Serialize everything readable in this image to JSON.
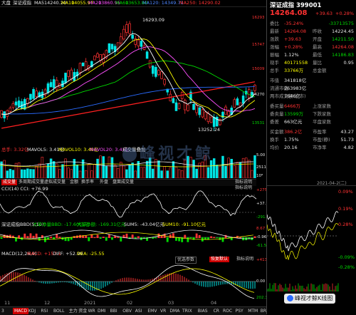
{
  "toolbar": {
    "items": [
      "大盘",
      "深证成指",
      "MA5",
      "14240.20",
      "MA10",
      "14055.97",
      "MA20",
      "13860.95",
      "MA60",
      "13653.80"
    ],
    "ma120": "MA120: 14349.71",
    "ma250": "MA250: 14290.02",
    "headers": [
      "大盘趋势",
      "九转",
      "大事件",
      "热点叠加",
      "成交"
    ]
  },
  "main_chart": {
    "high_label": "16293.09",
    "low_label": "13252.24",
    "axis": [
      "16293",
      "15747",
      "15009",
      "14270",
      "13531"
    ],
    "colors": {
      "up": "#ff3232",
      "down": "#00e5e5",
      "ma5": "#ffffff",
      "ma10": "#ffff00",
      "ma20": "#ff50ff",
      "ma60": "#00d900",
      "ma120": "#2a6bff",
      "ma250": "#ff2020"
    }
  },
  "volume": {
    "header": [
      "总手: 3.32亿",
      "MAVOL5: 3.41亿",
      "MAVOL10: 3.49亿",
      "MAVOL20: 3.41亿",
      "成交量叠加"
    ],
    "axis": [
      "5.00",
      "2511",
      "10⁸"
    ],
    "tabs": [
      "成交量",
      "多周期成交量",
      "虚拟成交量",
      "金额",
      "换手率",
      "外盘",
      "盘面成交量",
      "指标说明"
    ]
  },
  "cci": {
    "header": "CCI(14) CCI: +76.99",
    "axis": [
      "+275.9",
      "+37.74",
      "-291.1"
    ],
    "help": "指标说明"
  },
  "bbd": {
    "header": [
      "深证成指BBD(5,10)",
      "大单净量BBD: -17.60亿元",
      "大单净额: -169.31亿元",
      "SUM5: -43.04亿元",
      "SUM10: -91.10亿元"
    ],
    "axis": [
      "8.67",
      "-0.96",
      "-61.55"
    ],
    "help": "指标说明"
  },
  "macd": {
    "header": [
      "MACD(12,26,9)",
      "MACD: +157.1",
      "DIFF: +52.99",
      "DEA: -25.55"
    ],
    "axis": [
      "+413.4",
      "0.00",
      "202.3"
    ],
    "buttons": [
      "优选参数",
      "恢复默认",
      "指标说明"
    ]
  },
  "bottom_tabs": [
    "MACD",
    "KDJ",
    "RSI",
    "BOLL",
    "主力",
    "资金",
    "WR",
    "DMI",
    "BBI",
    "OBV",
    "ASI",
    "EMV",
    "VR",
    "DMA",
    "TRIX",
    "BIAS",
    "CR",
    "ROC",
    "PSY",
    "MTM",
    "BRAR",
    "CCI"
  ],
  "bottom_dates": [
    "11",
    "12",
    "2021",
    "02",
    "03",
    "04"
  ],
  "bottom_left": "3",
  "quote": {
    "title": "深证成指 399001",
    "price": "14264.08",
    "change": "+39.63",
    "change_pct": "+0.28%",
    "rows": [
      {
        "l": "委比",
        "v": "-35.24%",
        "l2": "",
        "v2": "-33713575",
        "vc": "red",
        "v2c": "green"
      },
      {
        "l": "最新",
        "v": "14264.08",
        "l2": "昨收",
        "v2": "14224.45",
        "vc": "red",
        "v2c": "white"
      },
      {
        "l": "涨跌",
        "v": "+39.63",
        "l2": "开盘",
        "v2": "14211.50",
        "vc": "red",
        "v2c": "green"
      },
      {
        "l": "涨幅",
        "v": "+0.28%",
        "l2": "最高",
        "v2": "14264.08",
        "vc": "red",
        "v2c": "red"
      },
      {
        "l": "振幅",
        "v": "1.12%",
        "l2": "最低",
        "v2": "14186.83",
        "vc": "white",
        "v2c": "green"
      },
      {
        "l": "现手",
        "v": "40171558",
        "l2": "量比",
        "v2": "0.95",
        "vc": "yellow",
        "v2c": "white"
      },
      {
        "l": "总手",
        "v": "33766万",
        "l2": "总金额",
        "v2": "",
        "vc": "yellow",
        "v2c": "white"
      }
    ],
    "rows2": [
      {
        "l": "市值",
        "v": "341818亿",
        "vc": "white"
      },
      {
        "l": "流通市值",
        "v": "263983亿",
        "vc": "white"
      },
      {
        "l": "两市成交额(沪市)",
        "v": "7646亿",
        "vc": "white"
      }
    ],
    "rows3": [
      {
        "l": "委买量",
        "v": "6466万",
        "l2": "上涨家数",
        "v2": "",
        "vc": "red"
      },
      {
        "l": "委卖量",
        "v": "13599万",
        "l2": "下跌家数",
        "v2": "",
        "vc": "green"
      },
      {
        "l": "委差",
        "v": "663亿元",
        "l2": "平盘家数",
        "v2": "",
        "vc": "white"
      }
    ],
    "rows4": [
      {
        "l": "买金额",
        "v": "386.2亿",
        "l2": "市盈率",
        "v2": "43.27",
        "vc": "red",
        "v2c": "white"
      },
      {
        "l": "换手",
        "v": "1.75%",
        "l2": "市盈(静)",
        "v2": "51.73",
        "vc": "white",
        "v2c": "white"
      },
      {
        "l": "均价",
        "v": "20.16",
        "l2": "市净率",
        "v2": "4.82",
        "vc": "white",
        "v2c": "white"
      }
    ],
    "date": "2021-04-2(二)",
    "mini_axis": [
      "0.09%",
      "0.19%",
      "0.28%",
      "-0.28%",
      "-0.09%"
    ]
  },
  "watermark": "峰视才鲸",
  "brand_badge": "峰视才鲸K线图"
}
